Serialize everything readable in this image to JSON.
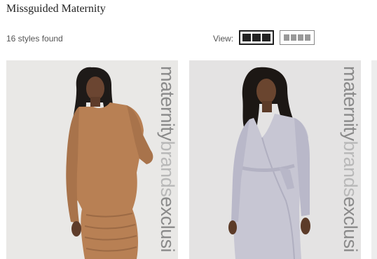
{
  "page": {
    "title": "Missguided Maternity",
    "results_count": "16 styles found"
  },
  "view": {
    "label": "View:",
    "options": [
      {
        "name": "three-per-row",
        "selected": true
      },
      {
        "name": "four-per-row",
        "selected": false
      }
    ]
  },
  "products": [
    {
      "banner": {
        "word1": "maternity",
        "word2": "brands",
        "word3": "exclusi"
      },
      "dress_color": "#b88054"
    },
    {
      "banner": {
        "word1": "maternity",
        "word2": "brands",
        "word3": "exclusi"
      },
      "dress_color": "#c7c6d3"
    }
  ],
  "colors": {
    "banner_dark": "#8a8a8a",
    "banner_light": "#b8b8b8",
    "selected_border": "#222222"
  }
}
